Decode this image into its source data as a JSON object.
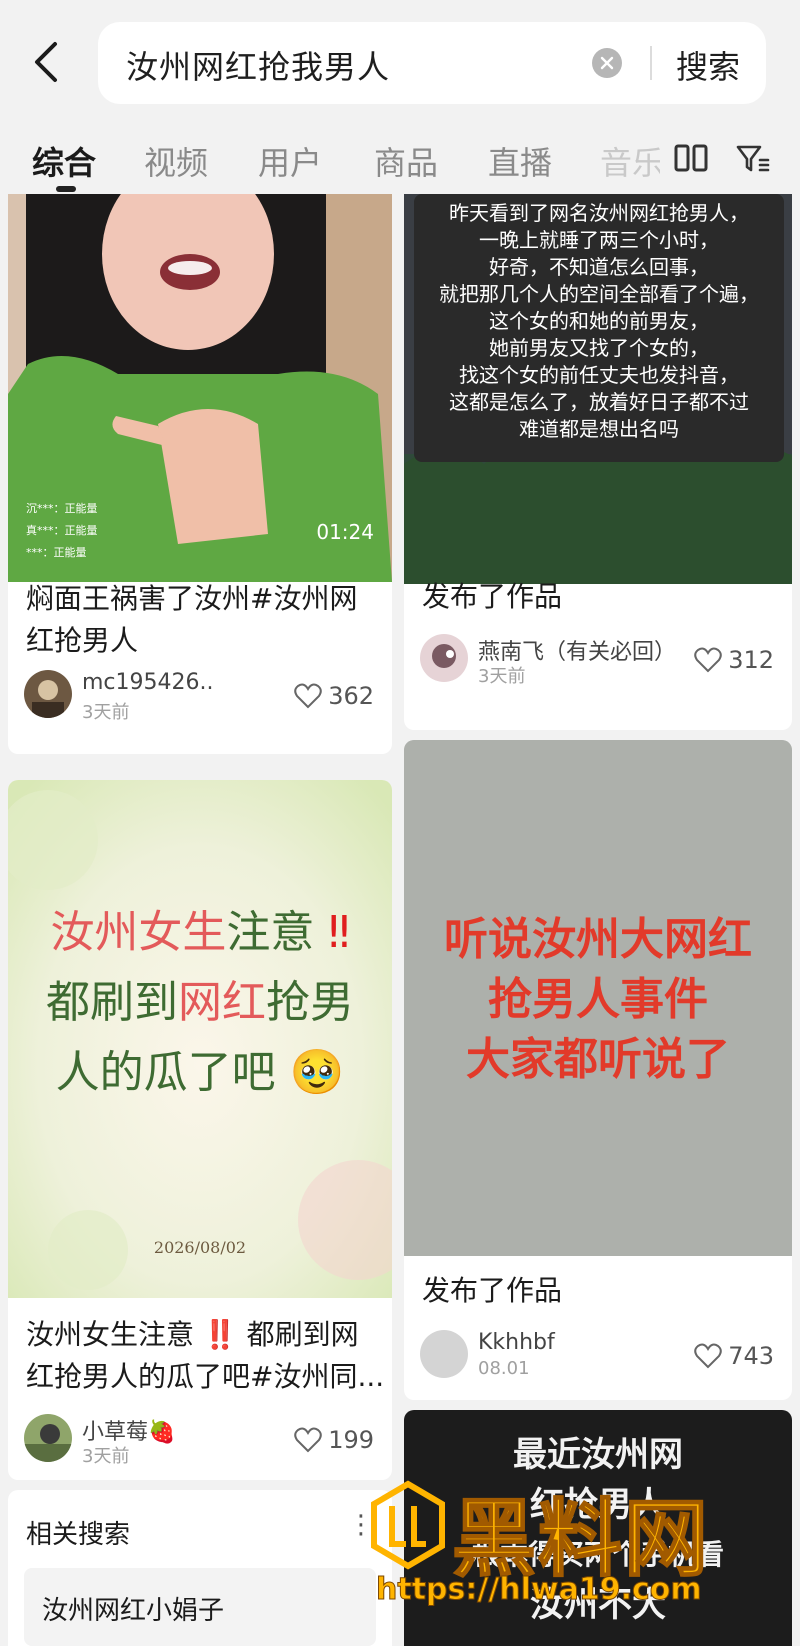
{
  "search": {
    "query": "汝州网红抢我男人",
    "button": "搜索"
  },
  "tabs": [
    "综合",
    "视频",
    "用户",
    "商品",
    "直播",
    "音乐"
  ],
  "cards": [
    {
      "title_line1": "焖面王祸害了汝州#汝州网",
      "title_line2": "红抢男人",
      "author": "mc195426..",
      "time": "3天前",
      "likes": "362",
      "duration": "01:24",
      "comments": [
        "沉***：正能量",
        "真***：正能量",
        "***：正能量"
      ]
    },
    {
      "overlay": [
        "昨天看到了网名汝州网红抢男人，",
        "一晚上就睡了两三个小时，",
        "好奇，不知道怎么回事，",
        "就把那几个人的空间全部看了个遍，",
        "这个女的和她的前男友，",
        "她前男友又找了个女的，",
        "找这个女的前任丈夫也发抖音，",
        "这都是怎么了，放着好日子都不过",
        "难道都是想出名吗"
      ],
      "title": "发布了作品",
      "author": "燕南飞（有关必回）",
      "time": "3天前",
      "likes": "312"
    },
    {
      "poster_line1a": "汝州女生",
      "poster_line1b": "注意",
      "poster_line2a": "都刷到",
      "poster_line2b": "网红",
      "poster_line2c": "抢男",
      "poster_line3": "人的瓜了吧",
      "poster_date": "2026/08/02",
      "title_line1": "汝州女生注意 ‼️ 都刷到网",
      "title_line2": "红抢男人的瓜了吧#汝州同...",
      "author": "小草莓🍓",
      "time": "3天前",
      "likes": "199"
    },
    {
      "poster": [
        "听说汝州大网红",
        "抢男人事件",
        "大家都听说了"
      ],
      "title": "发布了作品",
      "author": "Kkhhbf",
      "time": "08.01",
      "likes": "743"
    }
  ],
  "related": {
    "title": "相关搜索",
    "items": [
      "汝州网红小娟子"
    ]
  },
  "card5": {
    "poster": [
      "最近汝州网",
      "红抢男人",
      "根本得买两个手机看",
      "汝州不大"
    ]
  },
  "watermark": {
    "brand": "黑料网",
    "url": "https://hlwa19.com"
  }
}
